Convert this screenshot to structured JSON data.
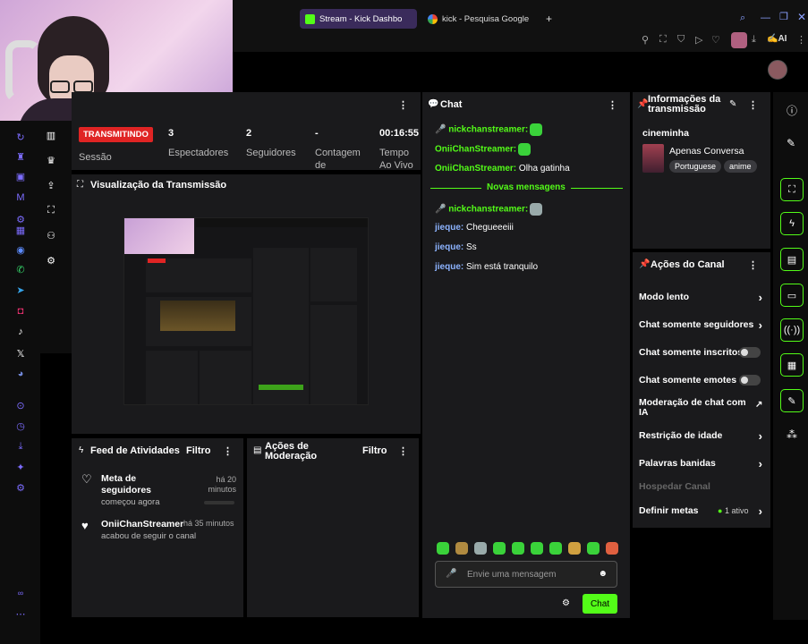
{
  "browser": {
    "tabs": [
      {
        "label": "Stream - Kick Dashbo",
        "active": true
      },
      {
        "label": "kick - Pesquisa Google",
        "active": false
      }
    ],
    "new_tab": "+",
    "toolbar_ai": "AI"
  },
  "stats": {
    "live_badge": "TRANSMITINDO",
    "session_label": "Sessão",
    "viewers_value": "3",
    "viewers_label": "Espectadores",
    "followers_value": "2",
    "followers_label": "Seguidores",
    "count_value": "-",
    "count_label": "Contagem de",
    "time_value": "00:16:55",
    "time_label": "Tempo Ao Vivo"
  },
  "preview": {
    "title": "Visualização da Transmissão"
  },
  "feed": {
    "title": "Feed de Atividades",
    "filter": "Filtro",
    "items": [
      {
        "title": "Meta de seguidores",
        "sub": "começou agora",
        "time": "há 20 minutos"
      },
      {
        "title": "OniiChanStreamer",
        "sub": "acabou de seguir o canal",
        "time": "há 35 minutos"
      }
    ]
  },
  "moderation": {
    "title": "Ações de Moderação",
    "filter": "Filtro"
  },
  "chat": {
    "title": "Chat",
    "messages": [
      {
        "user": "nickchanstreamer:",
        "text": ""
      },
      {
        "user": "OniiChanStreamer:",
        "text": ""
      },
      {
        "user": "OniiChanStreamer:",
        "text": "Olha gatinha"
      }
    ],
    "new_divider": "Novas mensagens",
    "new_messages": [
      {
        "user": "nickchanstreamer:",
        "text": ""
      },
      {
        "user": "jieque:",
        "text": "Chegueeeiii"
      },
      {
        "user": "jieque:",
        "text": "Ss"
      },
      {
        "user": "jieque:",
        "text": "Sim está tranquilo"
      }
    ],
    "placeholder": "Envie uma mensagem",
    "send_button": "Chat"
  },
  "info": {
    "title": "Informações da transmissão",
    "channel": "cineminha",
    "stream_title": "Apenas Conversa",
    "tags": [
      "Portuguese",
      "anime"
    ]
  },
  "actions": {
    "title": "Ações do Canal",
    "items": [
      {
        "label": "Modo lento",
        "kind": "chevron"
      },
      {
        "label": "Chat somente seguidores",
        "kind": "chevron"
      },
      {
        "label": "Chat somente inscritos",
        "kind": "toggle"
      },
      {
        "label": "Chat somente emotes",
        "kind": "toggle"
      },
      {
        "label": "Moderação de chat com IA",
        "kind": "external"
      },
      {
        "label": "Restrição de idade",
        "kind": "chevron"
      },
      {
        "label": "Palavras banidas",
        "kind": "chevron"
      },
      {
        "label": "Hospedar Canal",
        "kind": "disabled"
      },
      {
        "label": "Definir metas",
        "kind": "chevron",
        "extra": "1 ativo"
      }
    ]
  },
  "colors": {
    "accent": "#53fc18",
    "panel": "#1a1a1c",
    "live": "#e02424"
  }
}
